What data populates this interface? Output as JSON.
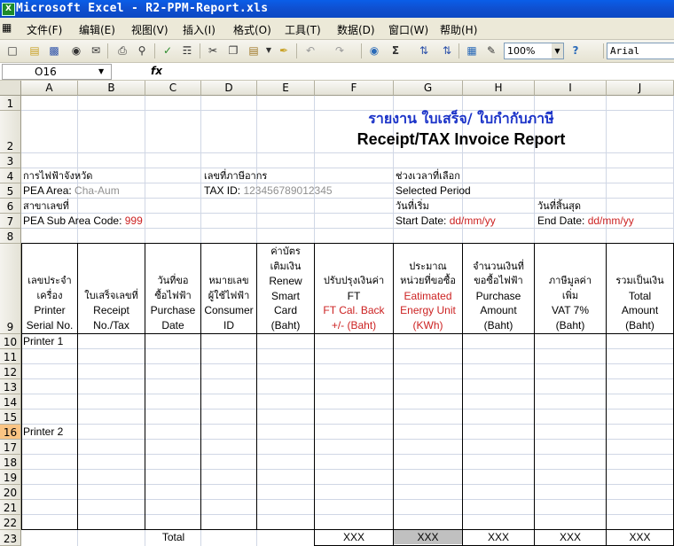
{
  "window": {
    "title": "Microsoft Excel - R2-PPM-Report.xls",
    "app_icon": "X"
  },
  "menu": [
    "文件(F)",
    "编辑(E)",
    "视图(V)",
    "插入(I)",
    "格式(O)",
    "工具(T)",
    "数据(D)",
    "窗口(W)",
    "帮助(H)"
  ],
  "toolbar": {
    "zoom": "100%",
    "font": "Arial",
    "icons": [
      "new-icon",
      "open-icon",
      "save-icon",
      "permission-icon",
      "email-icon",
      "print-icon",
      "print-preview-icon",
      "spelling-icon",
      "research-icon",
      "cut-icon",
      "copy-icon",
      "paste-icon",
      "format-painter-icon",
      "undo-icon",
      "redo-icon",
      "hyperlink-icon",
      "autosum-icon",
      "sort-asc-icon",
      "sort-desc-icon",
      "chart-wizard-icon",
      "drawing-icon",
      "help-icon"
    ]
  },
  "formula_bar": {
    "name_box": "O16",
    "fx": "fx",
    "value": ""
  },
  "columns": [
    "A",
    "B",
    "C",
    "D",
    "E",
    "F",
    "G",
    "H",
    "I",
    "J"
  ],
  "rows": [
    "1",
    "2",
    "3",
    "4",
    "5",
    "6",
    "7",
    "8",
    "9",
    "10",
    "11",
    "12",
    "13",
    "14",
    "15",
    "16",
    "17",
    "18",
    "19",
    "20",
    "21",
    "22",
    "23"
  ],
  "selected_row": "16",
  "report": {
    "title_thai": "รายงาน ใบเสร็จ/ ใบกำกับภาษี",
    "title_en": "Receipt/TAX Invoice Report",
    "r4": {
      "a": "การไฟฟ้าจังหวัด",
      "d": "เลขที่ภาษีอากร",
      "g": "ช่วงเวลาที่เลือก"
    },
    "r5": {
      "a_label": "PEA Area: ",
      "a_value": "Cha-Aum",
      "d_label": "TAX ID: ",
      "d_value": "123456789012345",
      "g": "Selected Period"
    },
    "r6": {
      "a": "สาขาเลขที่",
      "g": "วันที่เริ่ม",
      "i": "วันที่สิ้นสุด"
    },
    "r7": {
      "a_label": "PEA Sub Area Code: ",
      "a_value": "999",
      "g_label": "Start Date: ",
      "g_value": "dd/mm/yy",
      "i_label": "End Date: ",
      "i_value": "dd/mm/yy"
    },
    "headers": [
      {
        "thai": [
          "เลขประจำ",
          "เครื่อง"
        ],
        "en": [
          "Printer",
          "Serial No."
        ],
        "red": []
      },
      {
        "thai": [
          "ใบเสร็จเลขที่"
        ],
        "en": [
          "Receipt",
          "No./Tax"
        ],
        "red": []
      },
      {
        "thai": [
          "วันที่ขอ",
          "ซื้อไฟฟ้า"
        ],
        "en": [
          "Purchase",
          "Date"
        ],
        "red": []
      },
      {
        "thai": [
          "หมายเลข",
          "ผู้ใช้ไฟฟ้า"
        ],
        "en": [
          "Consumer",
          "ID"
        ],
        "red": []
      },
      {
        "thai": [
          "ค่าบัตร",
          "เติมเงิน"
        ],
        "en": [
          "Renew",
          "Smart",
          "Card",
          "(Baht)"
        ],
        "red": []
      },
      {
        "thai": [
          "ปรับปรุงเงินค่า"
        ],
        "en": [
          "FT"
        ],
        "red": [
          "FT Cal. Back",
          "+/- (Baht)"
        ]
      },
      {
        "thai": [
          "ประมาณ",
          "หน่วยที่ขอซื้อ"
        ],
        "en": [],
        "red": [
          "Eatimated",
          "Energy Unit",
          "(KWh)"
        ]
      },
      {
        "thai": [
          "จำนวนเงินที่",
          "ขอซื้อไฟฟ้า"
        ],
        "en": [
          "Purchase",
          "Amount",
          "(Baht)"
        ],
        "red": []
      },
      {
        "thai": [
          "ภาษีมูลค่า",
          "เพิ่ม"
        ],
        "en": [
          "VAT 7%",
          "(Baht)"
        ],
        "red": []
      },
      {
        "thai": [
          "รวมเป็นเงิน"
        ],
        "en": [
          "Total",
          "Amount",
          "(Baht)"
        ],
        "red": []
      }
    ],
    "printer1": "Printer 1",
    "printer2": "Printer 2",
    "total_label": "Total",
    "totals": {
      "f": "XXX",
      "g": "XXX",
      "h": "XXX",
      "i": "XXX",
      "j": "XXX"
    }
  }
}
